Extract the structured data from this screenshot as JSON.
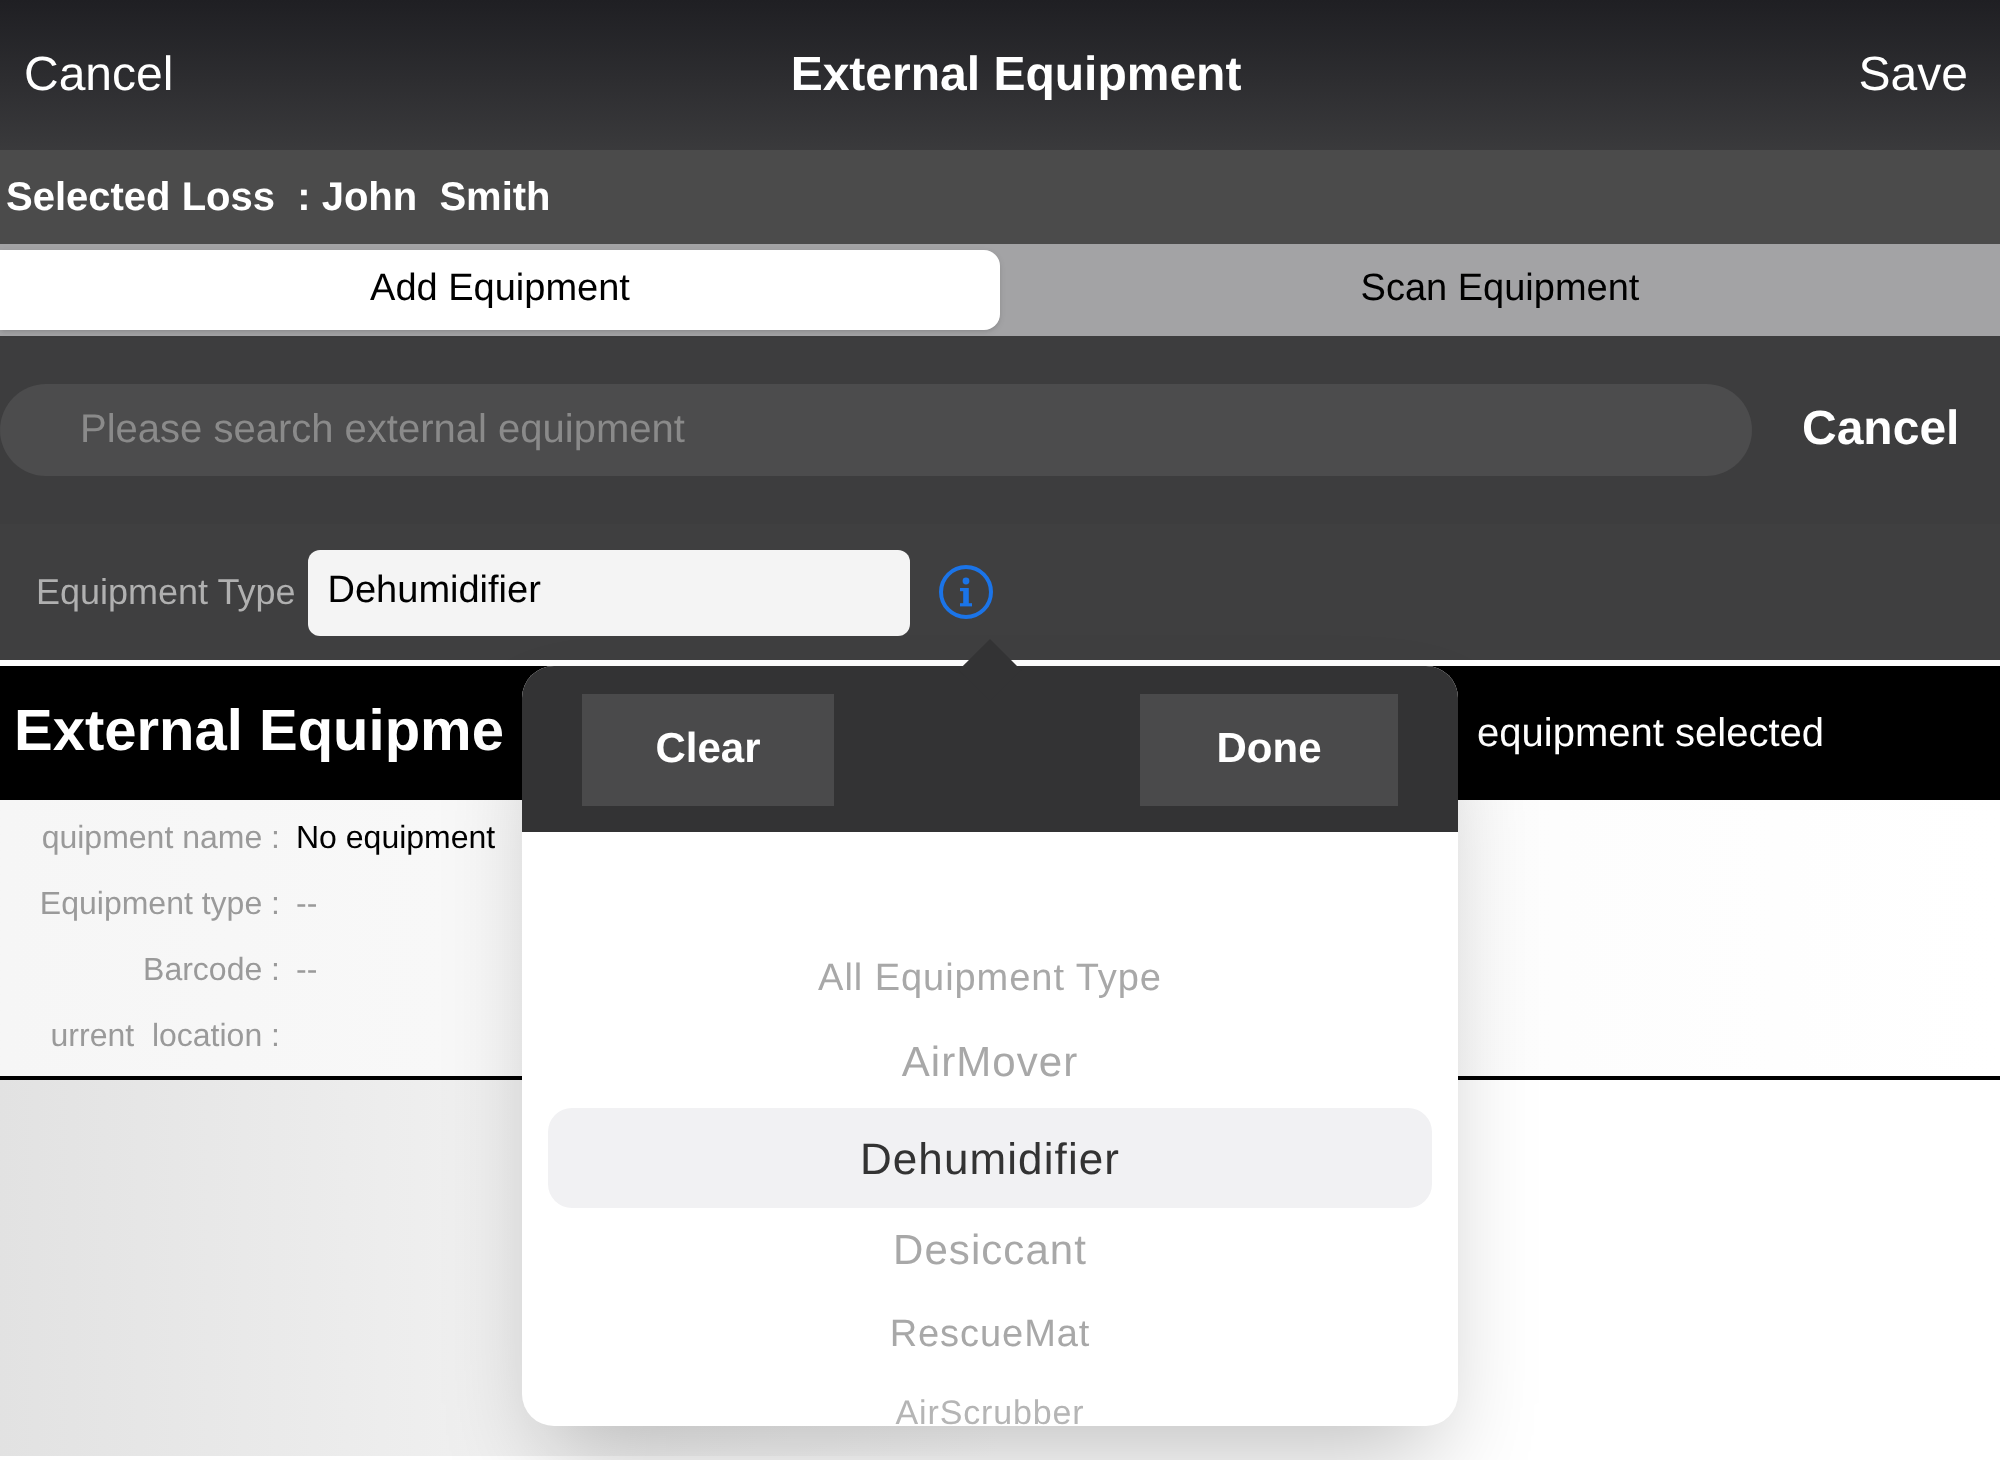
{
  "nav": {
    "left": "Cancel",
    "title": "External Equipment",
    "right": "Save"
  },
  "selected_loss": "Selected Loss  : John  Smith",
  "tabs": [
    {
      "label": "Add Equipment",
      "selected": true
    },
    {
      "label": "Scan Equipment",
      "selected": false
    }
  ],
  "search": {
    "placeholder": "Please search external equipment",
    "cancel": "Cancel"
  },
  "equipment_type": {
    "label": "Equipment Type",
    "value": "Dehumidifier"
  },
  "section": {
    "title": "External Equipme",
    "status": "equipment selected"
  },
  "details": [
    {
      "field": "quipment name :",
      "value": "No equipment"
    },
    {
      "field": "Equipment type :",
      "value": "--"
    },
    {
      "field": "Barcode :",
      "value": "--"
    },
    {
      "field": "urrent  location :"
    }
  ],
  "picker": {
    "clear": "Clear",
    "done": "Done",
    "options": [
      {
        "label": "All Equipment Type",
        "selected": false
      },
      {
        "label": "AirMover",
        "selected": false
      },
      {
        "label": "Dehumidifier",
        "selected": true
      },
      {
        "label": "Desiccant",
        "selected": false
      },
      {
        "label": "RescueMat",
        "selected": false
      },
      {
        "label": "AirScrubber",
        "selected": false
      }
    ]
  }
}
